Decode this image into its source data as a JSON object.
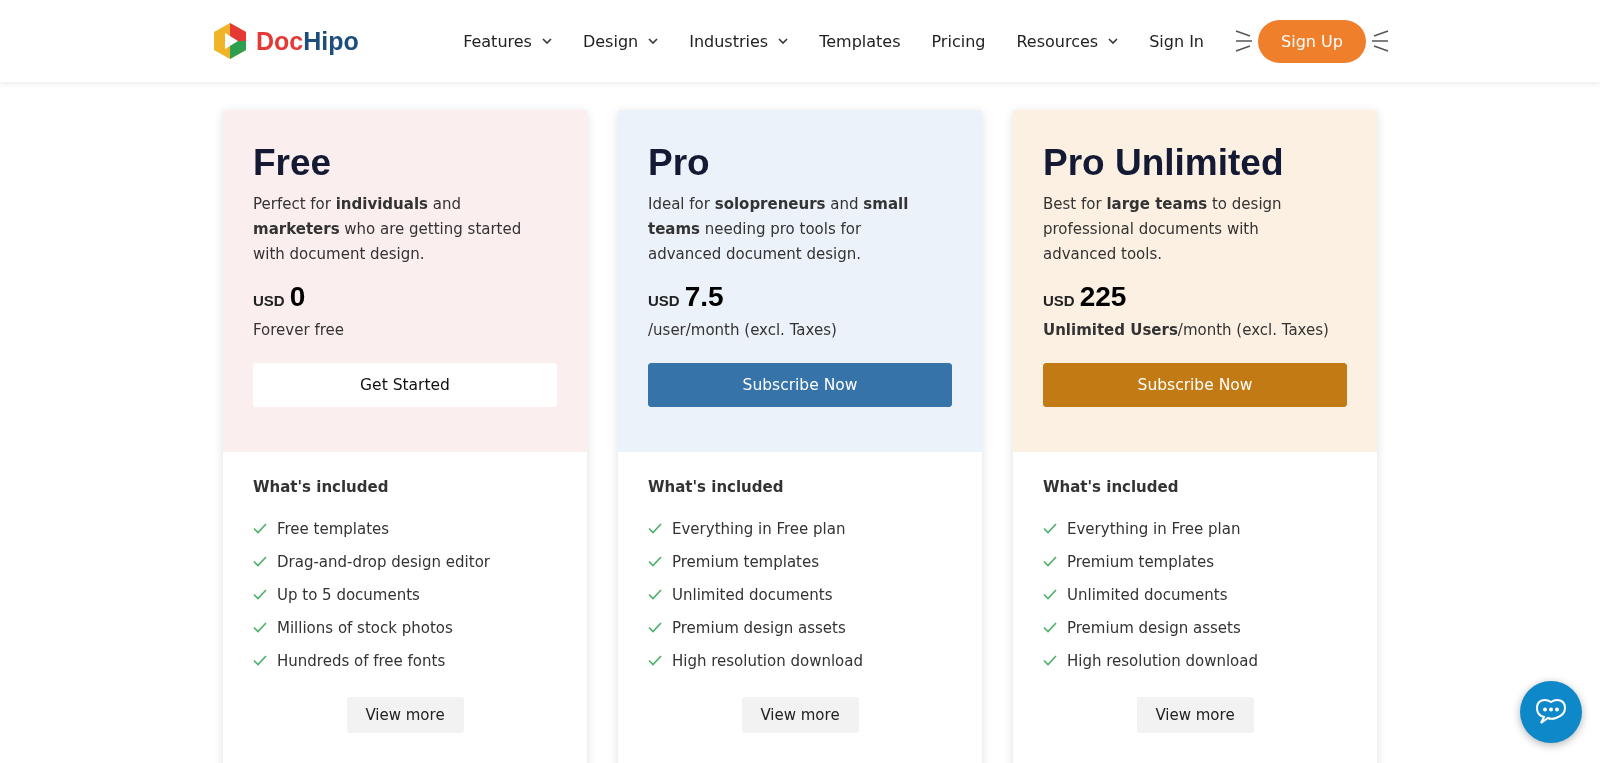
{
  "header": {
    "logo": {
      "text_1": "Doc",
      "text_2": "Hipo"
    },
    "nav": [
      {
        "label": "Features",
        "dropdown": true
      },
      {
        "label": "Design",
        "dropdown": true
      },
      {
        "label": "Industries",
        "dropdown": true
      },
      {
        "label": "Templates",
        "dropdown": false
      },
      {
        "label": "Pricing",
        "dropdown": false
      },
      {
        "label": "Resources",
        "dropdown": true
      },
      {
        "label": "Sign In",
        "dropdown": false
      }
    ],
    "signup": "Sign Up"
  },
  "plans": [
    {
      "name": "Free",
      "description": "Perfect for **individuals** and **marketers** who are getting started with document design.",
      "currency": "USD",
      "price": "0",
      "period": "Forever free",
      "color": "#fbeeee",
      "button": {
        "label": "Get Started",
        "color": "#ffffff",
        "kind": "light"
      },
      "included_title": "What's included",
      "features": [
        "Free templates",
        "Drag-and-drop design editor",
        "Up to 5 documents",
        "Millions of stock photos",
        "Hundreds of free fonts"
      ],
      "more": "View more"
    },
    {
      "name": "Pro",
      "description": "Ideal for **solopreneurs** and **small teams** needing pro tools for advanced document design.",
      "currency": "USD",
      "price": "7.5",
      "period": "/user/month (excl. Taxes)",
      "color": "#ebf2f9",
      "button": {
        "label": "Subscribe Now",
        "color": "#3673a9",
        "kind": "solid"
      },
      "included_title": "What's included",
      "features": [
        "Everything in Free plan",
        "Premium templates",
        "Unlimited documents",
        "Premium design assets",
        "High resolution download"
      ],
      "more": "View more"
    },
    {
      "name": "Pro Unlimited",
      "description": "Best for **large teams** to design professional documents with advanced tools.",
      "currency": "USD",
      "price": "225",
      "period": "**Unlimited Users**/month (excl. Taxes)",
      "color": "#fbf0e2",
      "button": {
        "label": "Subscribe Now",
        "color": "#c17a14",
        "kind": "solid"
      },
      "included_title": "What's included",
      "features": [
        "Everything in Free plan",
        "Premium templates",
        "Unlimited documents",
        "Premium design assets",
        "High resolution download"
      ],
      "more": "View more"
    }
  ]
}
